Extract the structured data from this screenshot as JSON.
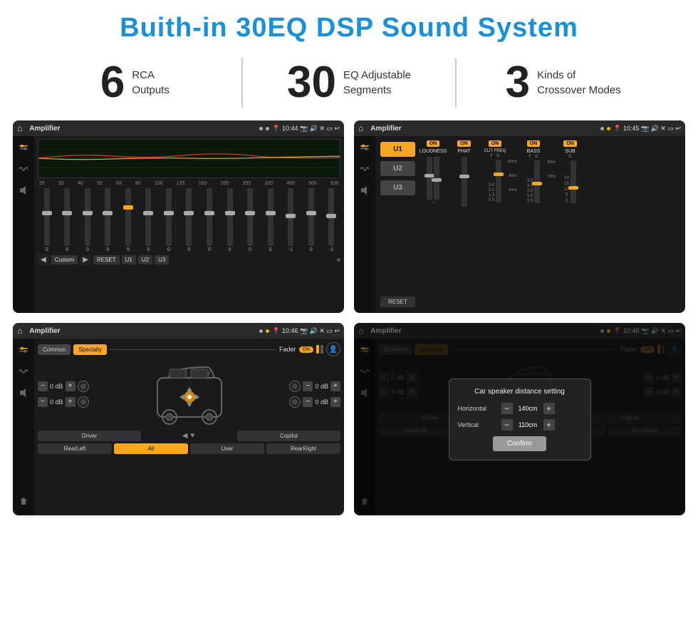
{
  "header": {
    "title": "Buith-in 30EQ DSP Sound System"
  },
  "stats": [
    {
      "number": "6",
      "line1": "RCA",
      "line2": "Outputs"
    },
    {
      "number": "30",
      "line1": "EQ Adjustable",
      "line2": "Segments"
    },
    {
      "number": "3",
      "line1": "Kinds of",
      "line2": "Crossover Modes"
    }
  ],
  "screens": [
    {
      "id": "eq-screen",
      "statusbar": {
        "title": "Amplifier",
        "time": "10:44"
      },
      "type": "eq"
    },
    {
      "id": "crossover-screen",
      "statusbar": {
        "title": "Amplifier",
        "time": "10:45"
      },
      "type": "crossover"
    },
    {
      "id": "fader-screen",
      "statusbar": {
        "title": "Amplifier",
        "time": "10:46"
      },
      "type": "fader"
    },
    {
      "id": "speaker-distance-screen",
      "statusbar": {
        "title": "Amplifier",
        "time": "10:46"
      },
      "type": "speaker-distance"
    }
  ],
  "eq": {
    "freqs": [
      "25",
      "32",
      "40",
      "50",
      "63",
      "80",
      "100",
      "125",
      "160",
      "200",
      "250",
      "320",
      "400",
      "500",
      "630"
    ],
    "values": [
      "0",
      "0",
      "0",
      "0",
      "5",
      "0",
      "0",
      "0",
      "0",
      "0",
      "0",
      "0",
      "-1",
      "0",
      "-1"
    ],
    "buttons": [
      "Custom",
      "RESET",
      "U1",
      "U2",
      "U3"
    ]
  },
  "crossover": {
    "units": [
      "U1",
      "U2",
      "U3"
    ],
    "controls": [
      "LOUDNESS",
      "PHAT",
      "CUT FREQ",
      "BASS",
      "SUB"
    ],
    "reset": "RESET"
  },
  "fader": {
    "tabs": [
      "Common",
      "Specialty"
    ],
    "activeTab": "Specialty",
    "faderLabel": "Fader",
    "onLabel": "ON",
    "volumes": [
      "0 dB",
      "0 dB",
      "0 dB",
      "0 dB"
    ],
    "positions": [
      "Driver",
      "Copilot",
      "RearLeft",
      "RearRight"
    ],
    "allBtn": "All",
    "userBtn": "User"
  },
  "modal": {
    "title": "Car speaker distance setting",
    "horizontal": {
      "label": "Horizontal",
      "value": "140cm"
    },
    "vertical": {
      "label": "Vertical",
      "value": "110cm"
    },
    "confirmBtn": "Confirm"
  }
}
